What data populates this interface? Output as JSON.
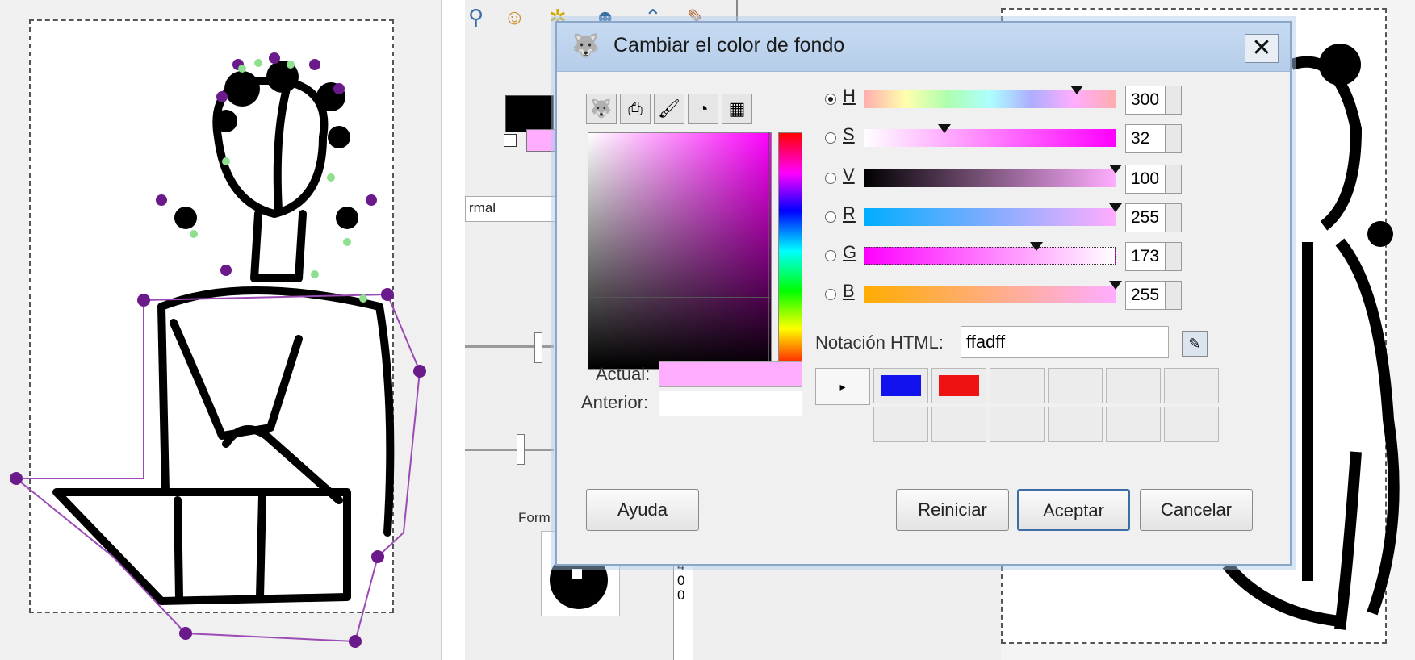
{
  "dialog": {
    "title": "Cambiar el color de fondo",
    "close_label": "✕"
  },
  "tabs": [
    {
      "icon": "gimp-wilber-icon"
    },
    {
      "icon": "scanner-icon"
    },
    {
      "icon": "brush-icon"
    },
    {
      "icon": "color-wheel-icon"
    },
    {
      "icon": "palette-icon"
    }
  ],
  "channels": [
    {
      "key": "H",
      "value": "300",
      "selected": true
    },
    {
      "key": "S",
      "value": "32",
      "selected": false
    },
    {
      "key": "V",
      "value": "100",
      "selected": false
    },
    {
      "key": "R",
      "value": "255",
      "selected": false
    },
    {
      "key": "G",
      "value": "173",
      "selected": false
    },
    {
      "key": "B",
      "value": "255",
      "selected": false
    }
  ],
  "html_notation": {
    "label": "Notación HTML:",
    "value": "ffadff"
  },
  "current": {
    "label": "Actual:",
    "color": "#ffadff"
  },
  "previous": {
    "label": "Anterior:",
    "color": "#ffffff"
  },
  "history_swatches": [
    "#1212ee",
    "#ee1212",
    "",
    "",
    "",
    "",
    "",
    "",
    "",
    "",
    "",
    ""
  ],
  "buttons": {
    "help": "Ayuda",
    "reset": "Reiniciar",
    "accept": "Aceptar",
    "cancel": "Cancelar"
  },
  "background_ui": {
    "mode_label": "rmal",
    "form_label": "Form",
    "ruler_numbers": [
      "4",
      "0",
      "0"
    ]
  }
}
